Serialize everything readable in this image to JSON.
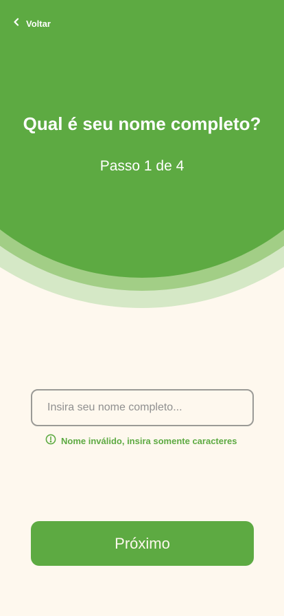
{
  "header": {
    "back_label": "Voltar",
    "title": "Qual é seu nome completo?",
    "step": "Passo 1 de 4"
  },
  "form": {
    "name_placeholder": "Insira seu nome completo...",
    "name_value": "",
    "error_text": "Nome inválido, insira somente caracteres"
  },
  "actions": {
    "next_label": "Próximo"
  },
  "colors": {
    "primary": "#5DAA42",
    "arc_mid": "#A2CE86",
    "arc_light": "#D5E8C6",
    "background": "#FEF8EE",
    "input_border": "#9A9A96"
  },
  "icons": {
    "back": "chevron-left-icon",
    "error": "alert-circle-icon"
  }
}
